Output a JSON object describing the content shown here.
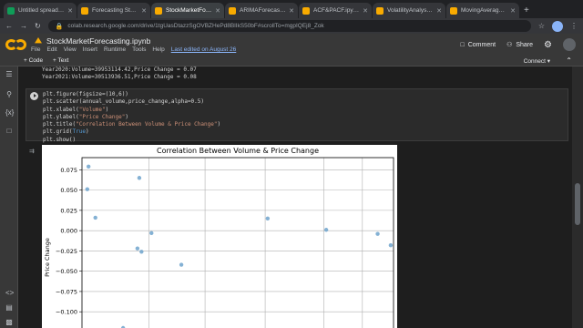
{
  "browser": {
    "tabs": [
      {
        "title": "Untitled spreadsheet",
        "color": "#0f9d58",
        "active": false
      },
      {
        "title": "Forecasting Stock Pr",
        "color": "#f9ab00",
        "active": false
      },
      {
        "title": "StockMarketForecast",
        "color": "#f9ab00",
        "active": true
      },
      {
        "title": "ARIMAForecastingBit",
        "color": "#f9ab00",
        "active": false
      },
      {
        "title": "ACF&PACF.ipynb - C",
        "color": "#f9ab00",
        "active": false
      },
      {
        "title": "VolatilityAnalysis.ipy",
        "color": "#f9ab00",
        "active": false
      },
      {
        "title": "MovingAverage.ipyn",
        "color": "#f9ab00",
        "active": false
      }
    ],
    "url": "colab.research.google.com/drive/1tgUasDtazzSgOVBZHePd8BlIkS50bF#scrollTo=mgpIQEj8_Zok"
  },
  "colab": {
    "notebook_title": "StockMarketForecasting.ipynb",
    "menus": [
      "File",
      "Edit",
      "View",
      "Insert",
      "Runtime",
      "Tools",
      "Help"
    ],
    "last_edited": "Last edited on August 26",
    "comment_label": "Comment",
    "share_label": "Share",
    "add_code": "+ Code",
    "add_text": "+ Text",
    "connect_label": "Connect"
  },
  "prev_output": [
    "Year2020:Volume=39953114.42,Price Change = 0.07",
    "Year2021:Volume=30513936.51,Price Change = 0.08"
  ],
  "code_lines": [
    "plt.figure(figsize=(10,6))",
    "plt.scatter(annual_volume,price_change,alpha=0.5)",
    "plt.xlabel(\"Volume\")",
    "plt.ylabel(\"Price Change\")",
    "plt.title(\"Correlation Between Volume & Price Change\")",
    "plt.grid(True)",
    "plt.show()"
  ],
  "chart_data": {
    "type": "scatter",
    "title": "Correlation Between Volume & Price Change",
    "ylabel": "Price Change",
    "xlabel": "",
    "ylim": [
      -0.12,
      0.09
    ],
    "xlim": [
      0,
      100
    ],
    "yticks": [
      0.075,
      0.05,
      0.025,
      0.0,
      -0.025,
      -0.05,
      -0.075,
      -0.1
    ],
    "ytick_labels": [
      "0.075",
      "0.050",
      "0.025",
      "0.000",
      "−0.025",
      "−0.050",
      "−0.075",
      "−0.100"
    ],
    "xgrid": [
      21.5,
      39.5,
      58.8,
      77.6,
      90.0
    ],
    "grid": true,
    "color": "#6fa3cc",
    "points": [
      {
        "x": 2.1,
        "y": 0.079
      },
      {
        "x": 1.7,
        "y": 0.051
      },
      {
        "x": 4.3,
        "y": 0.016
      },
      {
        "x": 18.4,
        "y": 0.065
      },
      {
        "x": 22.3,
        "y": -0.003
      },
      {
        "x": 17.8,
        "y": -0.022
      },
      {
        "x": 19.1,
        "y": -0.026
      },
      {
        "x": 31.9,
        "y": -0.042
      },
      {
        "x": 59.6,
        "y": 0.015
      },
      {
        "x": 78.4,
        "y": 0.001
      },
      {
        "x": 94.9,
        "y": -0.004
      },
      {
        "x": 99.1,
        "y": -0.018
      },
      {
        "x": 13.2,
        "y": -0.12
      }
    ]
  }
}
